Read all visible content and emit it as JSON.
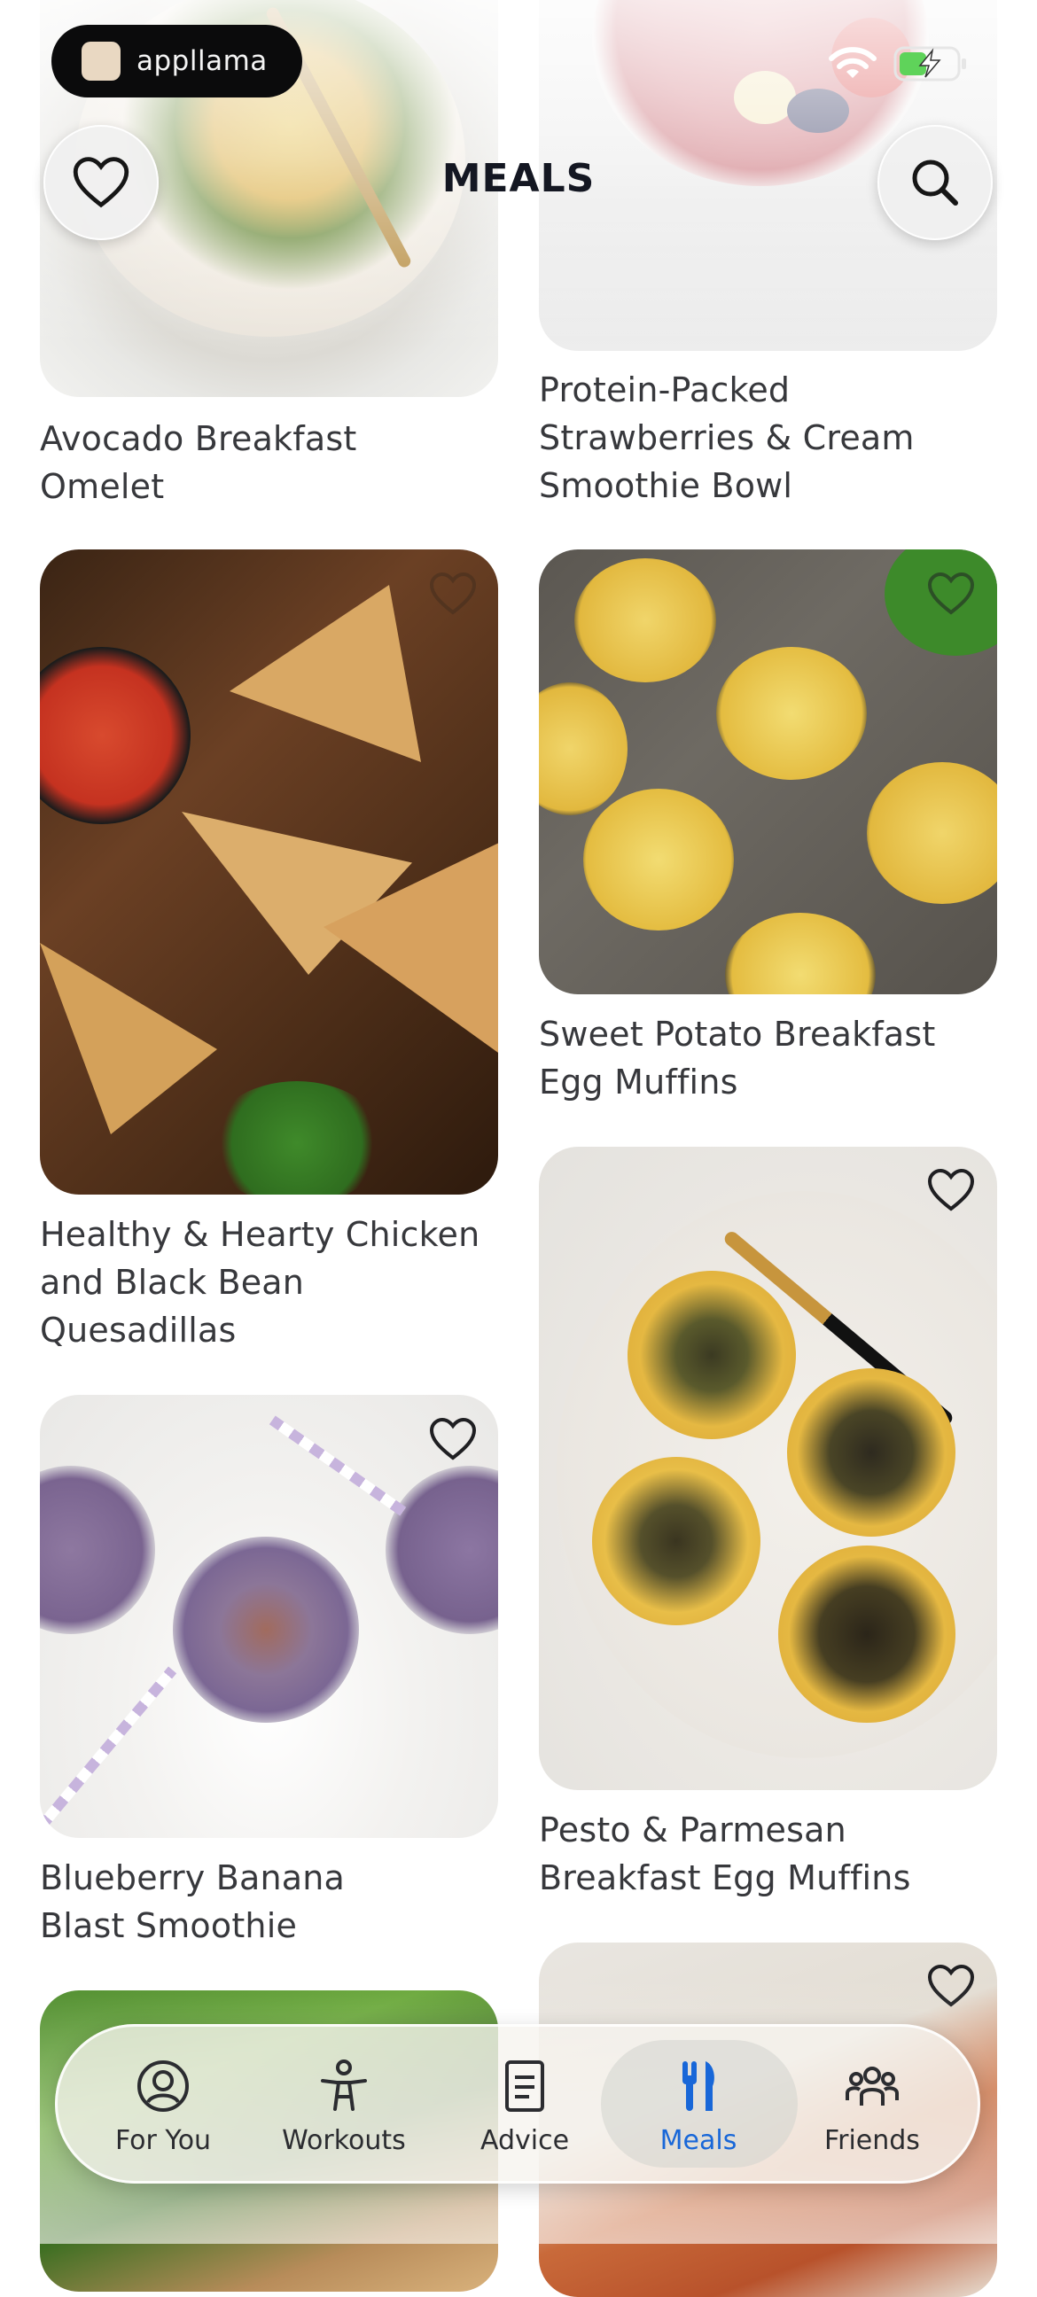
{
  "status_bar": {
    "carrier_logo_text": "appllama"
  },
  "header": {
    "title": "MEALS"
  },
  "recipes": {
    "left": [
      {
        "title_lines": [
          "Avocado Breakfast",
          "Omelet"
        ]
      },
      {
        "title_lines": [
          "Healthy & Hearty Chicken",
          "and Black Bean",
          "Quesadillas"
        ]
      },
      {
        "title_lines": [
          "Blueberry Banana",
          "Blast Smoothie"
        ]
      }
    ],
    "right": [
      {
        "title_lines": [
          "Protein-Packed",
          "Strawberries & Cream",
          "Smoothie Bowl"
        ]
      },
      {
        "title_lines": [
          "Sweet Potato Breakfast",
          "Egg Muffins"
        ]
      },
      {
        "title_lines": [
          "Pesto & Parmesan",
          "Breakfast Egg Muffins"
        ]
      }
    ]
  },
  "tabs": [
    {
      "label": "For You",
      "icon": "person-circle-icon"
    },
    {
      "label": "Workouts",
      "icon": "exercise-figure-icon"
    },
    {
      "label": "Advice",
      "icon": "document-icon"
    },
    {
      "label": "Meals",
      "icon": "fork-knife-icon",
      "active": true
    },
    {
      "label": "Friends",
      "icon": "group-icon"
    }
  ],
  "colors": {
    "accent": "#1867d8",
    "title": "#141722",
    "text": "#37383c"
  }
}
